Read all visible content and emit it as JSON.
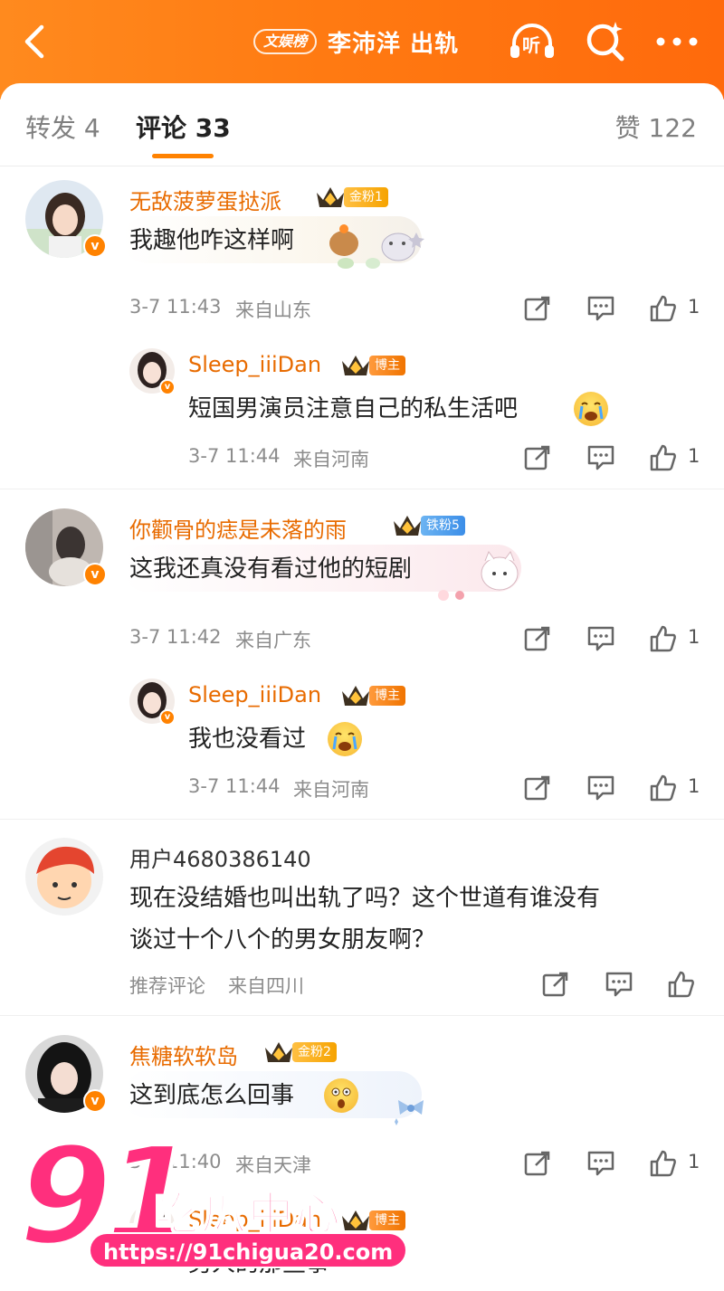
{
  "header": {
    "topic_tag": "文娱榜",
    "title": "李沛洋 出轨",
    "listen_label": "听",
    "brand_color": "#ff7a12"
  },
  "tabs": [
    {
      "label": "转发 4"
    },
    {
      "label": "评论 33"
    },
    {
      "label": "赞 122"
    }
  ],
  "comments": [
    {
      "user": "无敌菠萝蛋挞派",
      "badge": "金粉1",
      "text": "我趣他咋这样啊",
      "time": "3-7 11:43",
      "location": "来自山东",
      "likes": "1",
      "reply": {
        "user": "Sleep_iiiDan",
        "badge": "博主",
        "text": "短国男演员注意自己的私生活吧",
        "time": "3-7 11:44",
        "location": "来自河南",
        "likes": "1"
      }
    },
    {
      "user": "你颧骨的痣是未落的雨",
      "badge": "铁粉5",
      "text": "这我还真没有看过他的短剧",
      "time": "3-7 11:42",
      "location": "来自广东",
      "likes": "1",
      "reply": {
        "user": "Sleep_iiiDan",
        "badge": "博主",
        "text": "我也没看过",
        "time": "3-7 11:44",
        "location": "来自河南",
        "likes": "1"
      }
    },
    {
      "user": "用户4680386140",
      "text_lines": [
        "现在没结婚也叫出轨了吗？这个世道有谁没有",
        "谈过十个八个的男女朋友啊？"
      ],
      "time": "推荐评论",
      "location": "来自四川"
    },
    {
      "user": "焦糖软软岛",
      "badge": "金粉2",
      "text": "这到底怎么回事",
      "time": "3-7 11:40",
      "location": "来自天津",
      "likes": "1",
      "reply": {
        "user": "Sleep_iiiDan",
        "badge": "博主",
        "text": "男人的那些事"
      }
    }
  ],
  "watermark": {
    "number": "91",
    "name": "吃瓜中心",
    "url": "https://91chigua20.com",
    "color": "#ff2f7d"
  }
}
